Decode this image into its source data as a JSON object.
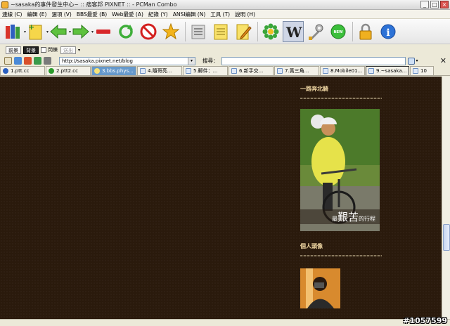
{
  "window": {
    "title": "~sasaka的事件發生中心~ :: 痞客邦 PIXNET :: - PCMan Combo",
    "buttons": [
      "minimize",
      "maximize",
      "close"
    ]
  },
  "menu": {
    "items": [
      "連線 (C)",
      "編輯 (E)",
      "選項 (V)",
      "BBS最愛 (B)",
      "Web最愛 (A)",
      "紀錄 (Y)",
      "ANSI編輯 (N)",
      "工具 (T)",
      "說明 (H)"
    ]
  },
  "toolbar": {
    "icons": [
      "books-icon",
      "new-page-icon",
      "back-arrow-icon",
      "forward-arrow-icon",
      "stop-line-icon",
      "refresh-icon",
      "no-entry-icon",
      "favorite-star-icon",
      "print-icon",
      "notepad-icon",
      "edit-pencil-icon",
      "flower-icon",
      "wikipedia-icon",
      "wrench-icon",
      "green-badge-icon",
      "lock-icon",
      "info-icon"
    ],
    "badge_label": "NEW"
  },
  "toolbar2": {
    "btn1": "前景",
    "btn2": "背景",
    "btn3": "閃爍",
    "btn4": "送出"
  },
  "address": {
    "url": "http://sasaka.pixnet.net/blog",
    "search_label": "搜尋：",
    "search_value": ""
  },
  "tabs": [
    {
      "label": "1.ptt.cc",
      "icon": "globe-blue"
    },
    {
      "label": "2.ptt2.cc",
      "icon": "globe-green"
    },
    {
      "label": "3.bbs.phys...",
      "icon": "bulb",
      "active": true
    },
    {
      "label": "4.隨哥亮...",
      "icon": "page"
    },
    {
      "label": "5.郵件：...",
      "icon": "page"
    },
    {
      "label": "6.新手交...",
      "icon": "page"
    },
    {
      "label": "7.黃三角...",
      "icon": "page"
    },
    {
      "label": "8.Mobile01...",
      "icon": "page"
    },
    {
      "label": "9.~sasaka...",
      "icon": "page"
    },
    {
      "label": "10",
      "icon": "page"
    }
  ],
  "sidebar": {
    "section1_title": "一路奔北騎",
    "photo_caption_prefix": "最",
    "photo_caption_big": "艱苦",
    "photo_caption_suffix": "的行程",
    "section2_title": "個人頭像"
  },
  "watermark": "#1057599",
  "colors": {
    "page_bg": "#2a1a0c",
    "sidebar_title": "#f0d7a3",
    "active_tab": "#6699cc"
  }
}
